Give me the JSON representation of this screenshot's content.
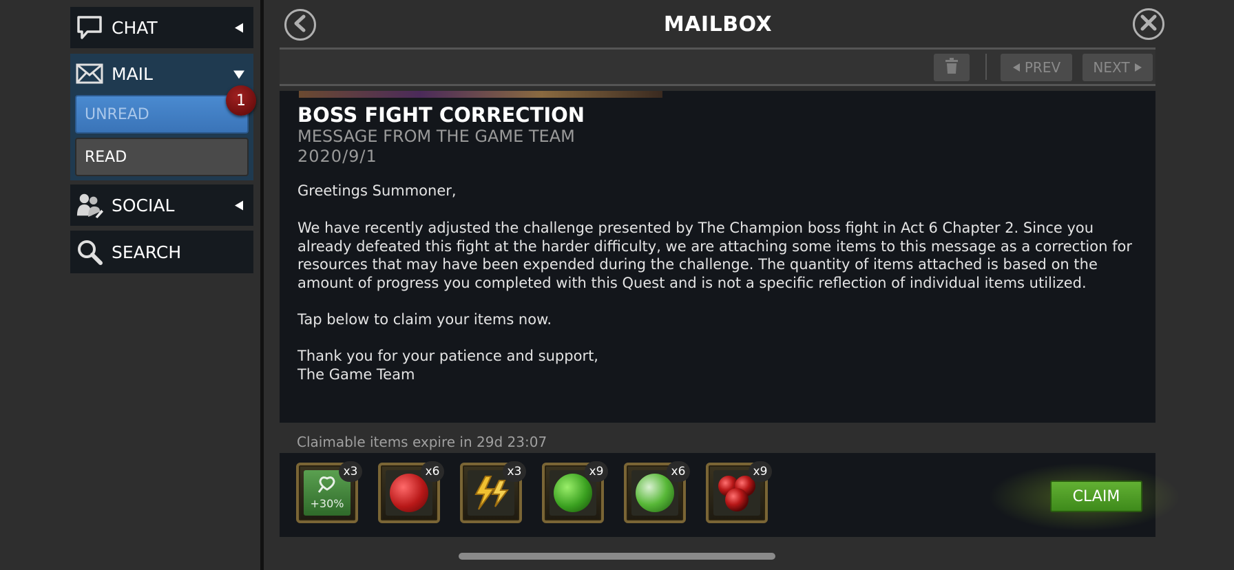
{
  "nav": {
    "chat_label": "CHAT",
    "mail_label": "MAIL",
    "unread_label": "UNREAD",
    "unread_count": "1",
    "read_label": "READ",
    "social_label": "SOCIAL",
    "search_label": "SEARCH"
  },
  "header": {
    "title": "MAILBOX"
  },
  "toolbar": {
    "prev_label": "PREV",
    "next_label": "NEXT"
  },
  "message": {
    "title": "BOSS FIGHT CORRECTION",
    "subtitle": "MESSAGE FROM THE GAME TEAM",
    "date": "2020/9/1",
    "greeting": "Greetings Summoner,",
    "body": "We have recently adjusted the challenge presented by The Champion boss fight in Act 6 Chapter 2. Since you already defeated this fight at the harder difficulty, we are attaching some items to this message as a correction for resources that may have been expended during the challenge. The quantity of items attached is based on the amount of progress you completed with this Quest and is not a specific reflection of individual items utilized.",
    "cta": "Tap below to claim your items now.",
    "signoff_line1": "Thank you for your patience and support,",
    "signoff_line2": "The Game Team"
  },
  "rewards": {
    "expire_text": "Claimable items expire in 29d 23:07",
    "items": [
      {
        "icon": "xp-boost-icon",
        "qty": "x3",
        "label": "+30%"
      },
      {
        "icon": "red-health-potion-icon",
        "qty": "x6"
      },
      {
        "icon": "energy-refill-icon",
        "qty": "x3"
      },
      {
        "icon": "green-revive-potion-icon",
        "qty": "x9"
      },
      {
        "icon": "green-silver-potion-icon",
        "qty": "x6"
      },
      {
        "icon": "red-team-potion-icon",
        "qty": "x9"
      }
    ],
    "claim_label": "CLAIM"
  },
  "colors": {
    "accent_blue": "#3a74b8",
    "claim_green": "#4e9e25",
    "badge_red": "#7a0d0d"
  }
}
